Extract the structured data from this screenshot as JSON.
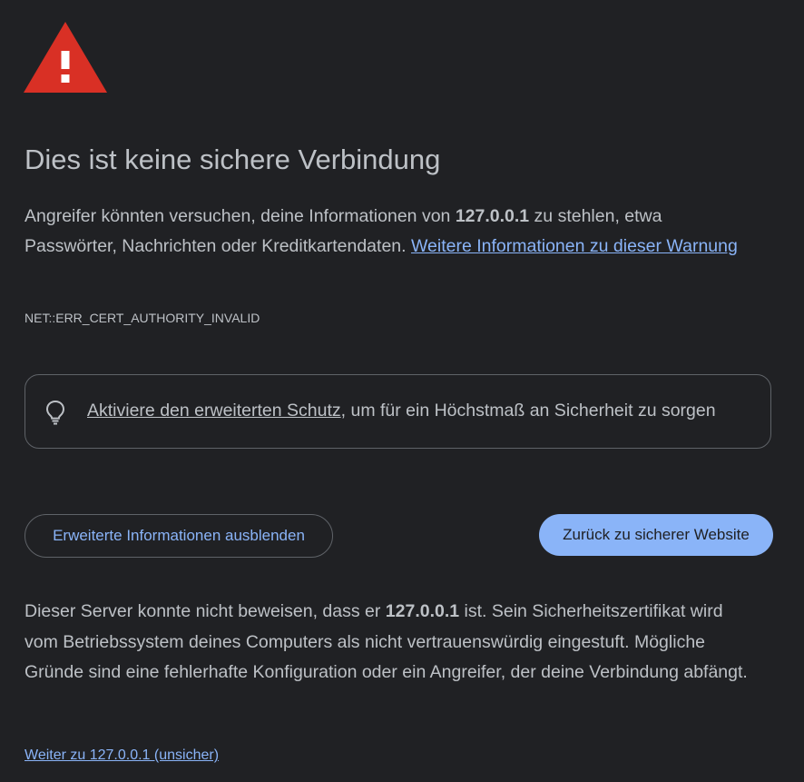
{
  "icon": {
    "name": "warning-triangle-icon",
    "color": "#d93025"
  },
  "title": "Dies ist keine sichere Verbindung",
  "main_message": {
    "part1": "Angreifer könnten versuchen, deine Informationen von ",
    "host": "127.0.0.1",
    "part2": " zu stehlen, etwa Passwörter, Nachrichten oder Kreditkartendaten. ",
    "learn_more": "Weitere Informationen zu dieser Warnung"
  },
  "error_code": "NET::ERR_CERT_AUTHORITY_INVALID",
  "enhanced_protection": {
    "icon": "lightbulb-icon",
    "link": "Aktiviere den erweiterten Schutz",
    "suffix": ", um für ein Höchstmaß an Sicherheit zu sorgen"
  },
  "buttons": {
    "details": "Erweiterte Informationen ausblenden",
    "back": "Zurück zu sicherer Website"
  },
  "details": {
    "part1": "Dieser Server konnte nicht beweisen, dass er ",
    "host": "127.0.0.1",
    "part2": " ist. Sein Sicherheitszertifikat wird vom Betriebssystem deines Computers als nicht vertrauenswürdig eingestuft. Mögliche Gründe sind eine fehlerhafte Konfiguration oder ein Angreifer, der deine Verbindung abfängt."
  },
  "proceed_link": "Weiter zu 127.0.0.1 (unsicher)",
  "colors": {
    "background": "#202124",
    "text": "#bdc1c6",
    "link": "#8ab4f8",
    "primary_button": "#8ab4f8",
    "border": "#5f6368"
  }
}
